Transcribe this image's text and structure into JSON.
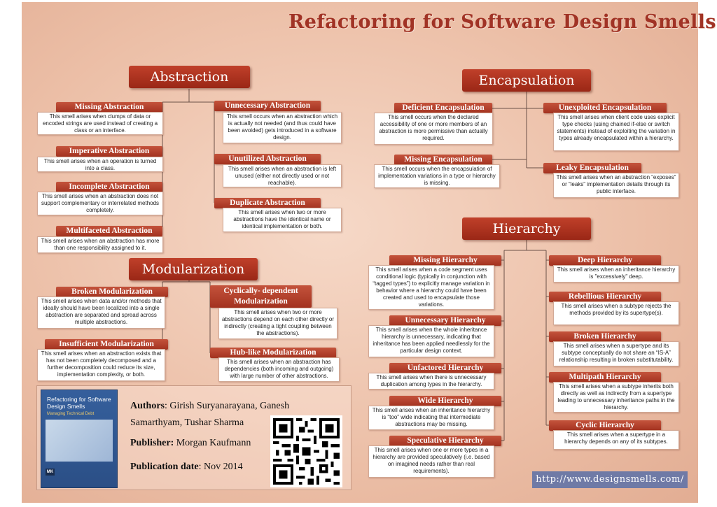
{
  "title": "Refactoring for Software Design Smells",
  "categories": {
    "abstraction": "Abstraction",
    "encapsulation": "Encapsulation",
    "modularization": "Modularization",
    "hierarchy": "Hierarchy"
  },
  "abstraction": [
    {
      "name": "Missing Abstraction",
      "desc": "This smell arises when clumps of data or encoded strings are used instead of creating a class or an interface."
    },
    {
      "name": "Imperative Abstraction",
      "desc": "This smell arises when an operation is turned into a class."
    },
    {
      "name": "Incomplete Abstraction",
      "desc": "This smell arises when an abstraction does not support complementary or interrelated methods completely."
    },
    {
      "name": "Multifaceted Abstraction",
      "desc": "This smell arises when an abstraction has more than one responsibility assigned to it."
    },
    {
      "name": "Unnecessary Abstraction",
      "desc": "This smell occurs when an abstraction which is actually not needed (and thus could have been avoided) gets introduced in a software design."
    },
    {
      "name": "Unutilized Abstraction",
      "desc": "This smell arises when an abstraction is left unused (either not directly used or not reachable)."
    },
    {
      "name": "Duplicate Abstraction",
      "desc": "This smell arises when two or more abstractions have the identical name or identical implementation or both."
    }
  ],
  "encapsulation": [
    {
      "name": "Deficient Encapsulation",
      "desc": "This smell occurs when the declared accessibility of one or more members of an abstraction is more permissive than actually required."
    },
    {
      "name": "Missing Encapsulation",
      "desc": "This smell occurs when the encapsulation of implementation variations in a type or hierarchy is missing."
    },
    {
      "name": "Unexploited Encapsulation",
      "desc": "This smell arises when client code uses explicit type checks (using chained if-else or switch statements) instead of exploiting the variation in types already encapsulated within a hierarchy."
    },
    {
      "name": "Leaky Encapsulation",
      "desc": "This smell arises when an abstraction “exposes” or “leaks” implementation details through its public interface."
    }
  ],
  "modularization": [
    {
      "name": "Broken Modularization",
      "desc": "This smell arises when data and/or methods that ideally should have been localized into a single abstraction are separated and spread across multiple abstractions."
    },
    {
      "name": "Insufficient Modularization",
      "desc": "This smell arises when an abstraction exists that has not been completely decomposed and a further decomposition could reduce its size, implementation complexity, or both."
    },
    {
      "name": "Cyclically- dependent Modularization",
      "desc": "This smell arises when two or more abstractions depend on each other directly or indirectly (creating a tight coupling between the abstractions)."
    },
    {
      "name": "Hub-like Modularization",
      "desc": "This smell arises when an abstraction has dependencies (both incoming and outgoing) with large number of other abstractions."
    }
  ],
  "hierarchy": [
    {
      "name": "Missing Hierarchy",
      "desc": "This smell arises when a code segment uses conditional logic (typically in conjunction with “tagged types”) to explicitly manage variation in behavior where a hierarchy could have been created and used to encapsulate those variations."
    },
    {
      "name": "Unnecessary Hierarchy",
      "desc": "This smell arises when the whole inheritance hierarchy is unnecessary, indicating that inheritance has been applied needlessly for the particular design context."
    },
    {
      "name": "Unfactored Hierarchy",
      "desc": "This smell arises when there is unnecessary duplication among types in the hierarchy."
    },
    {
      "name": "Wide Hierarchy",
      "desc": "This smell arises when an inheritance hierarchy is “too” wide indicating that intermediate abstractions may be missing."
    },
    {
      "name": "Speculative Hierarchy",
      "desc": "This smell arises when one or more types in a hierarchy are provided speculatively (i.e. based on imagined needs rather than real requirements)."
    },
    {
      "name": "Deep Hierarchy",
      "desc": "This smell arises when an inheritance hierarchy is \"excessively\" deep."
    },
    {
      "name": "Rebellious Hierarchy",
      "desc": "This smell arises when a subtype rejects the methods provided by its supertype(s)."
    },
    {
      "name": "Broken Hierarchy",
      "desc": "This smell arises when a supertype and its subtype conceptually do not share an “IS-A” relationship resulting in broken substitutability."
    },
    {
      "name": "Multipath Hierarchy",
      "desc": "This smell arises when a subtype inherits both directly as well as indirectly from a supertype leading to unnecessary inheritance paths in the hierarchy."
    },
    {
      "name": "Cyclic Hierarchy",
      "desc": "This smell arises when a supertype in a hierarchy depends on any of its subtypes."
    }
  ],
  "book": {
    "cover_title": "Refactoring for Software Design Smells",
    "cover_subtitle": "Managing Technical Debt",
    "cover_logo": "MK",
    "authors_label": "Authors",
    "authors": ": Girish Suryanarayana, Ganesh",
    "authors_line2": "Samarthyam, Tushar Sharma",
    "publisher_label": "Publisher:",
    "publisher": " Morgan Kaufmann",
    "date_label": "Publication date",
    "date": ": Nov 2014"
  },
  "url": "http://www.designsmells.com/",
  "colors": {
    "accent": "#a3321f",
    "background": "#ecbfa7",
    "url_bg": "#6f7aa6"
  }
}
